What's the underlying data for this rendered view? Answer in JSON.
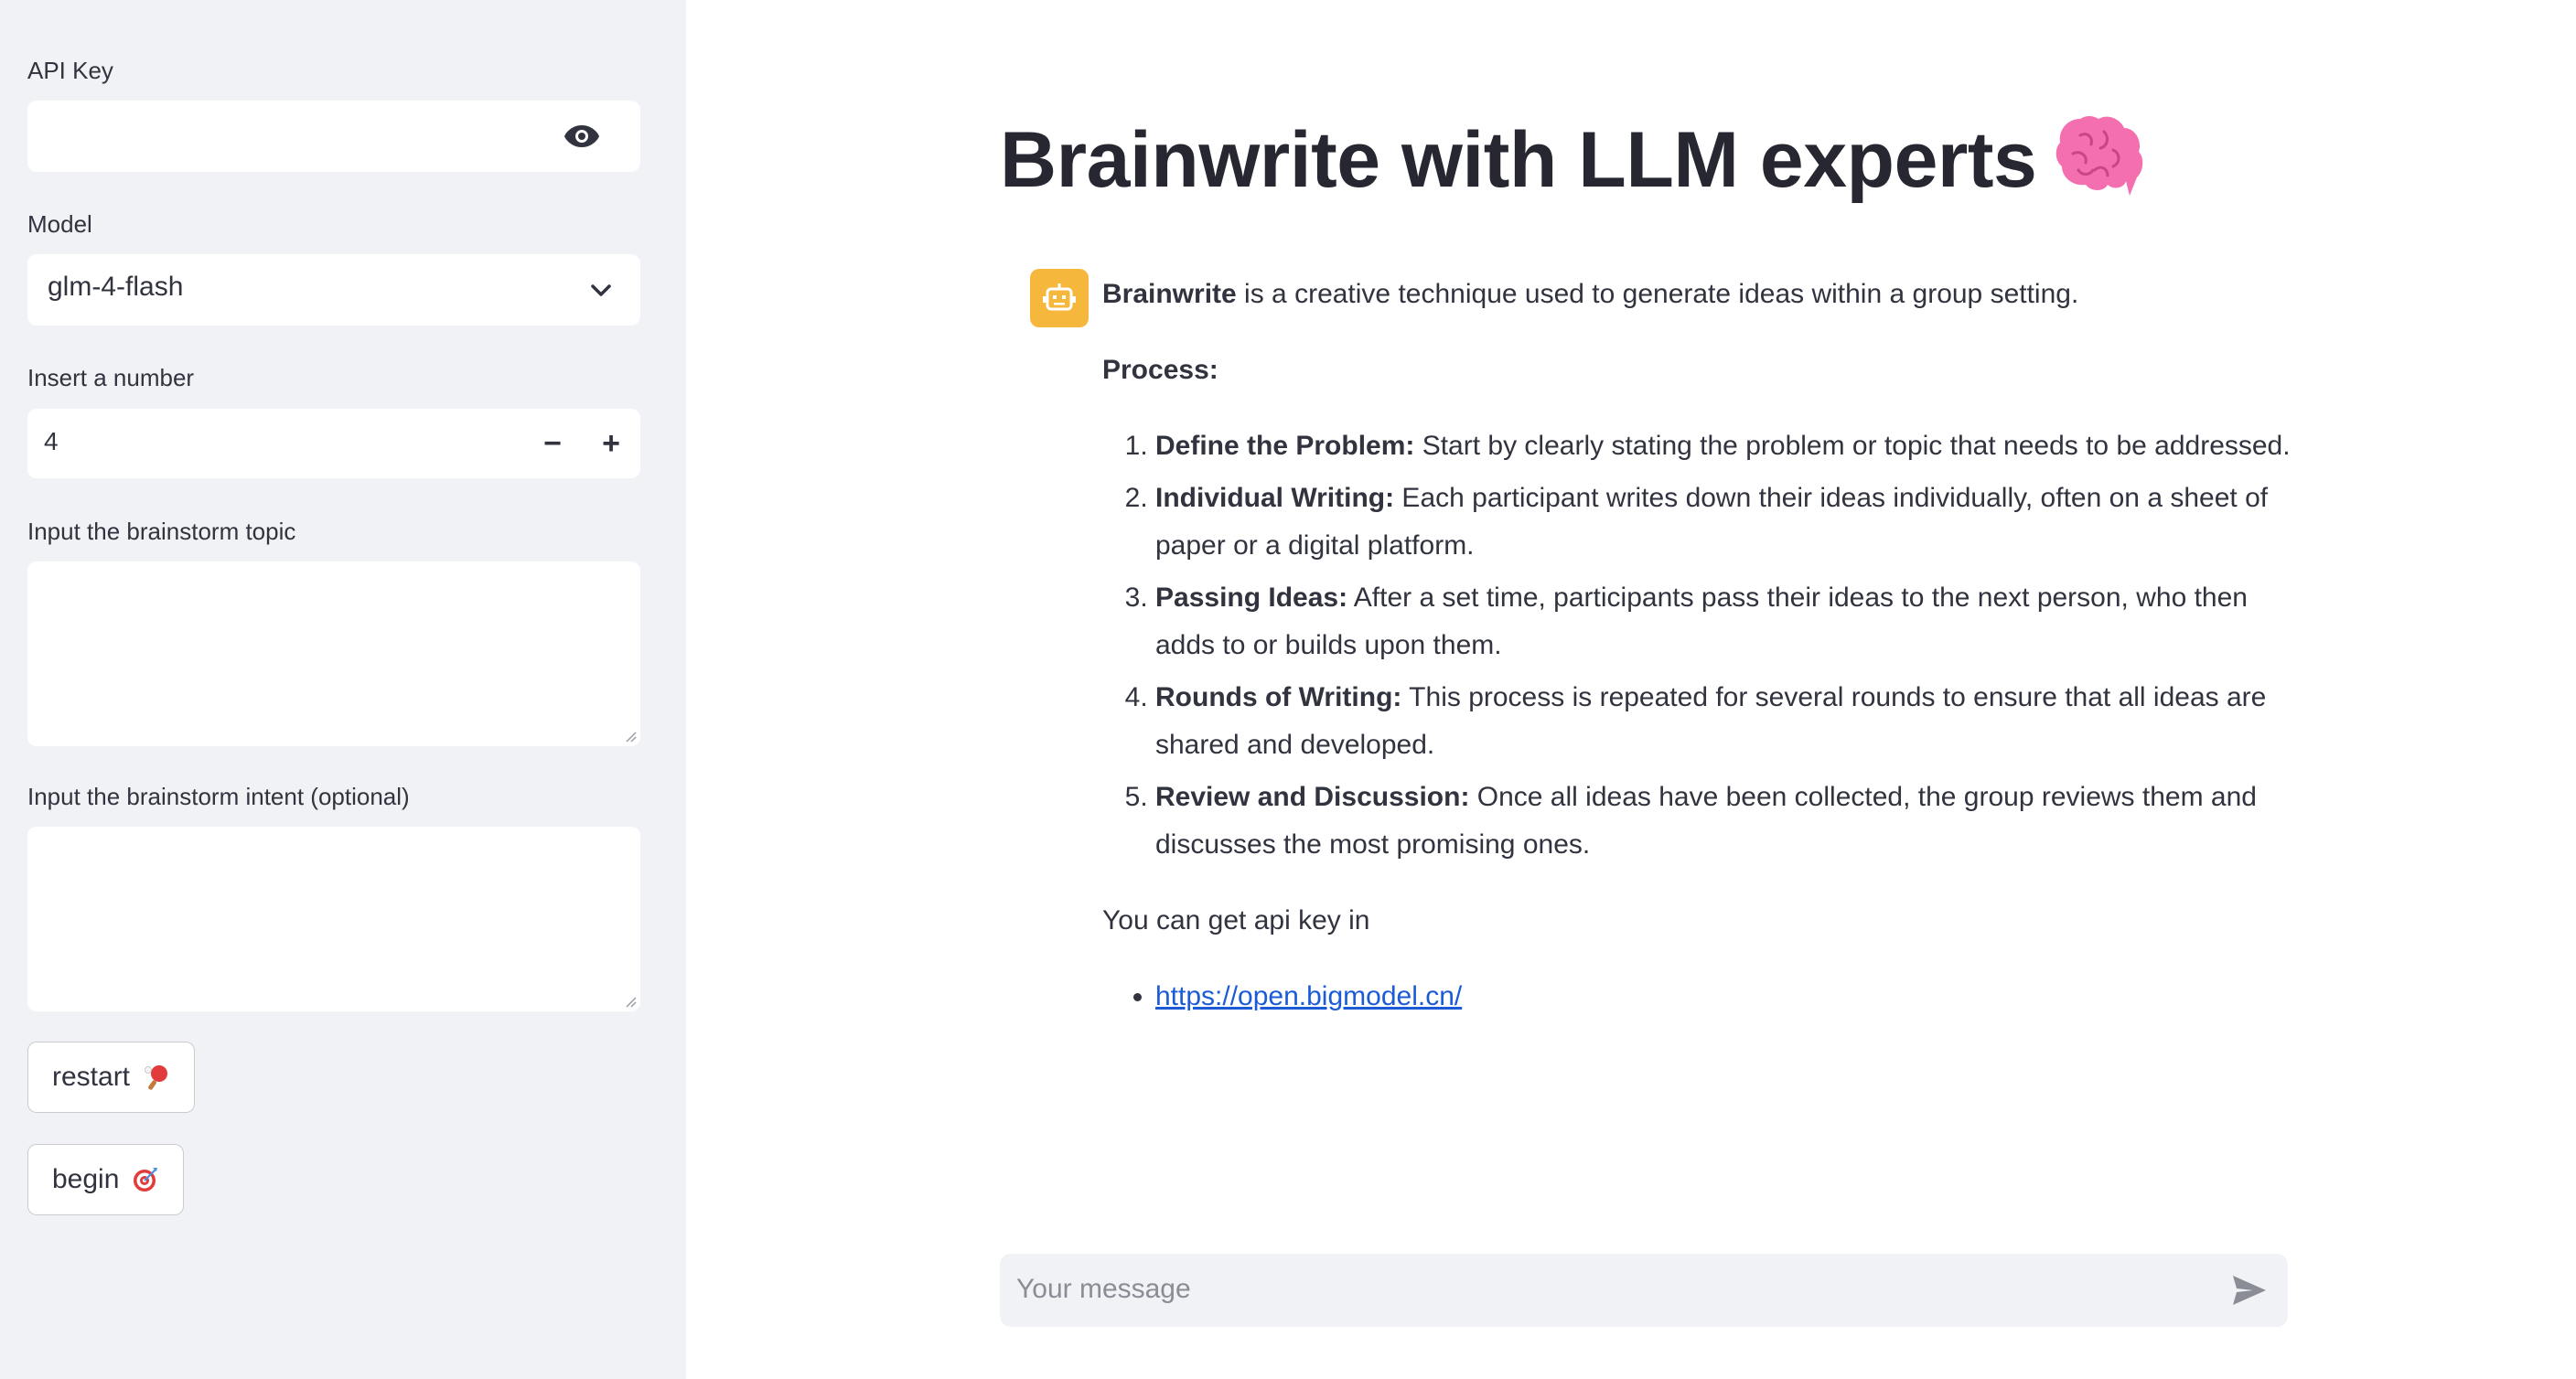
{
  "sidebar": {
    "api_key": {
      "label": "API Key",
      "value": "",
      "icon": "eye-icon"
    },
    "model": {
      "label": "Model",
      "value": "glm-4-flash",
      "icon": "chevron-down-icon"
    },
    "number": {
      "label": "Insert a number",
      "value": "4",
      "minus": "−",
      "plus": "+"
    },
    "topic": {
      "label": "Input the brainstorm topic",
      "value": ""
    },
    "intent": {
      "label": "Input the brainstorm intent (optional)",
      "value": ""
    },
    "restart_button": {
      "label": "restart",
      "icon": "ping-pong-icon"
    },
    "begin_button": {
      "label": "begin",
      "icon": "direct-hit-icon"
    }
  },
  "main": {
    "title": "Brainwrite with LLM experts",
    "title_icon": "brain-icon",
    "assistant_avatar": "robot-icon",
    "message": {
      "intro_bold": "Brainwrite",
      "intro_rest": " is a creative technique used to generate ideas within a group setting.",
      "process_heading": "Process:",
      "steps": [
        {
          "title": "Define the Problem:",
          "text": " Start by clearly stating the problem or topic that needs to be addressed."
        },
        {
          "title": "Individual Writing:",
          "text": " Each participant writes down their ideas individually, often on a sheet of paper or a digital platform."
        },
        {
          "title": "Passing Ideas:",
          "text": " After a set time, participants pass their ideas to the next person, who then adds to or builds upon them."
        },
        {
          "title": "Rounds of Writing:",
          "text": " This process is repeated for several rounds to ensure that all ideas are shared and developed."
        },
        {
          "title": "Review and Discussion:",
          "text": " Once all ideas have been collected, the group reviews them and discusses the most promising ones."
        }
      ],
      "api_note": "You can get api key in",
      "links": [
        "https://open.bigmodel.cn/"
      ]
    },
    "chat_input": {
      "placeholder": "Your message",
      "icon": "send-icon"
    }
  },
  "colors": {
    "sidebar_bg": "#f0f2f6",
    "text": "#31333f",
    "avatar_bg": "#f5b83d",
    "link": "#1c5bd6"
  }
}
